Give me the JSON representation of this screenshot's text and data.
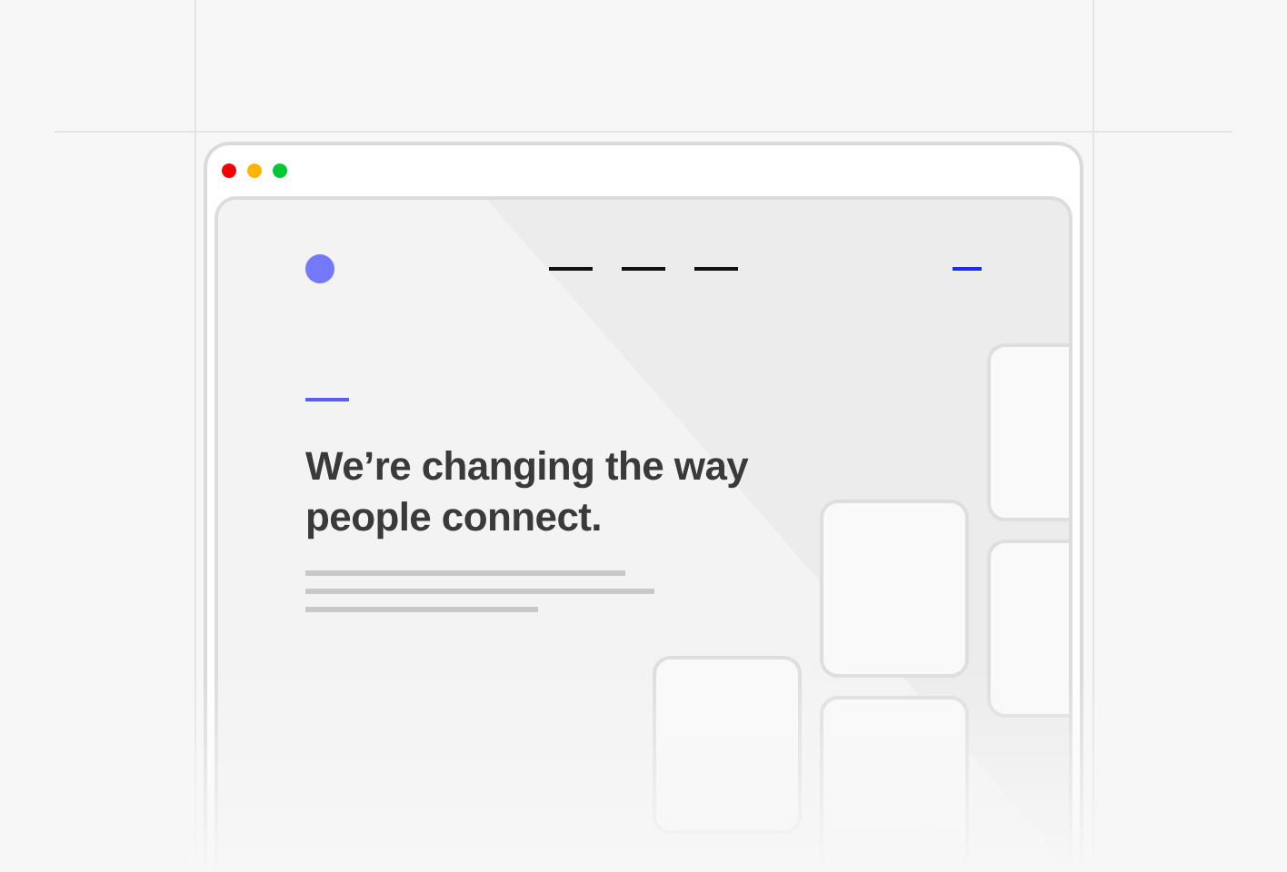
{
  "hero": {
    "headline": "We’re changing the way people connect."
  }
}
